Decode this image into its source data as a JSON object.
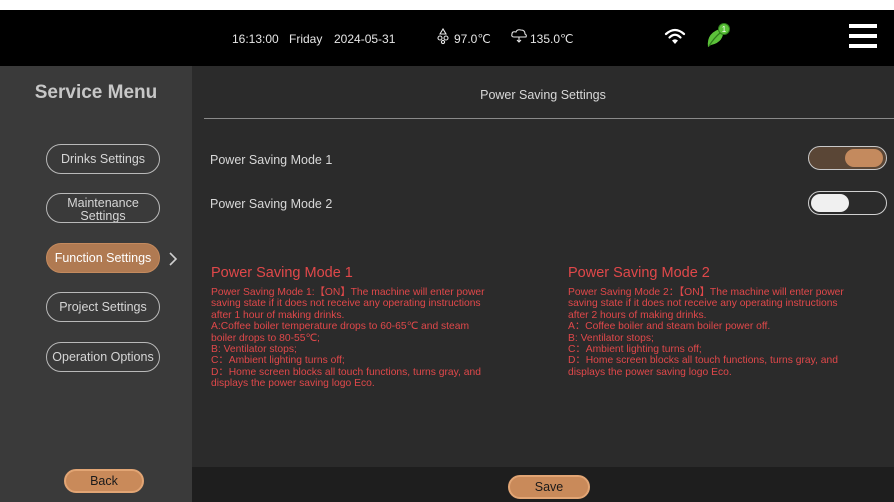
{
  "status_bar": {
    "time": "16:13:00",
    "day": "Friday",
    "date": "2024-05-31",
    "temp_coffee_boiler": "97.0℃",
    "temp_steam_boiler": "135.0℃",
    "icons": [
      "coffee-boiler-icon",
      "steam-boiler-icon",
      "wifi-icon",
      "eco-leaf-icon",
      "hamburger-menu-icon"
    ],
    "eco_badge": "1"
  },
  "sidebar": {
    "title": "Service Menu",
    "items": [
      {
        "label": "Drinks Settings",
        "active": false
      },
      {
        "label": "Maintenance Settings",
        "active": false
      },
      {
        "label": "Function Settings",
        "active": true
      },
      {
        "label": "Project Settings",
        "active": false
      },
      {
        "label": "Operation Options",
        "active": false
      }
    ],
    "back_label": "Back"
  },
  "main": {
    "title": "Power Saving Settings",
    "modes": [
      {
        "label": "Power Saving Mode 1",
        "enabled": true
      },
      {
        "label": "Power Saving Mode 2",
        "enabled": false
      }
    ],
    "descriptions": [
      {
        "heading": "Power Saving Mode 1",
        "lines": [
          "Power Saving Mode 1:【ON】The machine will enter power",
          "saving state if it does not receive any operating instructions",
          "after 1 hour of making drinks.",
          " A:Coffee boiler temperature drops to 60-65℃ and steam",
          "boiler drops to 80-55℃;",
          " B: Ventilator stops;",
          " C：Ambient lighting turns off;",
          " D：Home screen blocks all touch functions, turns gray, and",
          "displays the power saving logo Eco."
        ]
      },
      {
        "heading": "Power Saving Mode 2",
        "lines": [
          "Power Saving Mode 2：【ON】The machine will enter power",
          "saving state if it does not receive any operating instructions",
          "after 2 hours of making drinks.",
          " A：Coffee boiler and steam boiler power off.",
          " B: Ventilator stops;",
          " C：Ambient lighting turns off;",
          " D：Home screen blocks all touch functions, turns gray, and",
          "displays the power saving logo Eco."
        ]
      }
    ],
    "save_label": "Save"
  },
  "colors": {
    "accent": "#c98a5a",
    "description_text": "#e0484a",
    "eco_leaf": "#5cc23a"
  }
}
